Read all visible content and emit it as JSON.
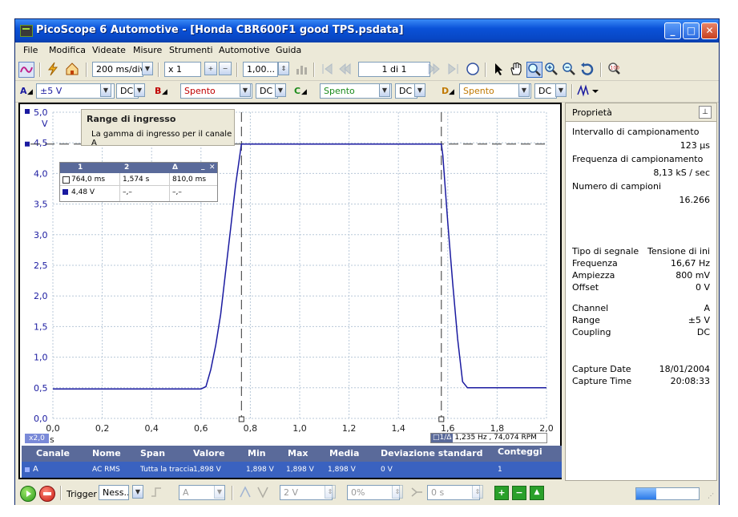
{
  "window": {
    "title": "PicoScope 6 Automotive - [Honda CBR600F1 good TPS.psdata]"
  },
  "menu": [
    "File",
    "Modifica",
    "Videate",
    "Misure",
    "Strumenti",
    "Automotive",
    "Guida"
  ],
  "toolbar": {
    "timebase": "200 ms/div",
    "zoom": "x 1",
    "multiplier": "1,00...",
    "page": "1 di 1"
  },
  "channels": [
    {
      "letter": "A",
      "range": "±5 V",
      "coupling": "DC",
      "color": "#1a1aa0"
    },
    {
      "letter": "B",
      "range": "Spento",
      "coupling": "DC",
      "color": "#c00000"
    },
    {
      "letter": "C",
      "range": "Spento",
      "coupling": "DC",
      "color": "#1a8a1a"
    },
    {
      "letter": "D",
      "range": "Spento",
      "coupling": "DC",
      "color": "#c07800"
    }
  ],
  "tooltip": {
    "title": "Range di ingresso",
    "text": "La gamma di ingresso per il canale A"
  },
  "ruler_table": {
    "headers": [
      "1",
      "2",
      "Δ"
    ],
    "rows": [
      [
        "764,0 ms",
        "1,574 s",
        "810,0 ms"
      ],
      [
        "4,48 V",
        "–,–",
        "–,–"
      ]
    ]
  },
  "y_unit": "V",
  "x_unit": "s",
  "x_zoom": "x2,0",
  "freq_readout": "1,235 Hz , 74,074 RPM",
  "chart_data": {
    "type": "line",
    "x_ticks": [
      "0,0",
      "0,2",
      "0,4",
      "0,6",
      "0,8",
      "1,0",
      "1,2",
      "1,4",
      "1,6",
      "1,8",
      "2,0"
    ],
    "y_ticks": [
      "0,0",
      "0,5",
      "1,0",
      "1,5",
      "2,0",
      "2,5",
      "3,0",
      "3,5",
      "4,0",
      "4,5",
      "5,0"
    ],
    "xlim": [
      0,
      2.0
    ],
    "ylim": [
      0,
      5.0
    ],
    "series": [
      {
        "name": "A",
        "values": [
          0.48,
          0.48,
          0.48,
          0.48,
          0.48,
          0.48,
          0.48,
          0.48,
          0.52,
          0.8,
          1.2,
          1.7,
          2.4,
          3.1,
          3.8,
          4.48,
          4.48,
          4.48,
          4.48,
          4.48,
          4.48,
          4.48,
          4.48,
          4.48,
          4.48,
          4.48,
          4.48,
          4.48,
          4.48,
          4.48,
          4.48,
          4.48,
          4.48,
          4.48,
          4.3,
          3.2,
          2.2,
          1.3,
          0.6,
          0.5,
          0.5,
          0.5,
          0.5,
          0.5,
          0.5
        ],
        "x": [
          0,
          0.1,
          0.2,
          0.3,
          0.4,
          0.5,
          0.55,
          0.6,
          0.62,
          0.64,
          0.66,
          0.68,
          0.7,
          0.72,
          0.74,
          0.764,
          0.8,
          0.9,
          1.0,
          1.1,
          1.2,
          1.3,
          1.4,
          1.45,
          1.5,
          1.52,
          1.54,
          1.55,
          1.56,
          1.565,
          1.57,
          1.572,
          1.573,
          1.574,
          1.58,
          1.6,
          1.62,
          1.64,
          1.66,
          1.68,
          1.7,
          1.8,
          1.9,
          1.95,
          2.0
        ]
      }
    ],
    "rulers": {
      "x": [
        0.764,
        1.574
      ],
      "y": [
        4.48
      ]
    },
    "grid": true
  },
  "measurements": {
    "headers": [
      "Canale",
      "Nome",
      "Span",
      "Valore",
      "Min",
      "Max",
      "Media",
      "Deviazione standard",
      "Conteggi"
    ],
    "row": [
      "A",
      "AC RMS",
      "Tutta la traccia",
      "1,898 V",
      "1,898 V",
      "1,898 V",
      "1,898 V",
      "0 V",
      "1"
    ]
  },
  "properties": {
    "title": "Proprietà",
    "items": [
      {
        "label": "Intervallo di campionamento",
        "value": "123 µs"
      },
      {
        "label": "Frequenza di campionamento",
        "value": "8,13 kS / sec"
      },
      {
        "label": "Numero di campioni",
        "value": "16.266"
      }
    ],
    "signal": [
      {
        "label": "Tipo di segnale",
        "value": "Tensione di ini"
      },
      {
        "label": "Frequenza",
        "value": "16,67 Hz"
      },
      {
        "label": "Ampiezza",
        "value": "800 mV"
      },
      {
        "label": "Offset",
        "value": "0 V"
      }
    ],
    "channel": [
      {
        "label": "Channel",
        "value": "A"
      },
      {
        "label": "Range",
        "value": "±5 V"
      },
      {
        "label": "Coupling",
        "value": "DC"
      }
    ],
    "capture": [
      {
        "label": "Capture Date",
        "value": "18/01/2004"
      },
      {
        "label": "Capture Time",
        "value": "20:08:33"
      }
    ]
  },
  "bottom": {
    "trigger_label": "Trigger",
    "trigger_mode": "Ness...",
    "channel": "A",
    "level": "2 V",
    "percent": "0%",
    "delay": "0 s"
  }
}
